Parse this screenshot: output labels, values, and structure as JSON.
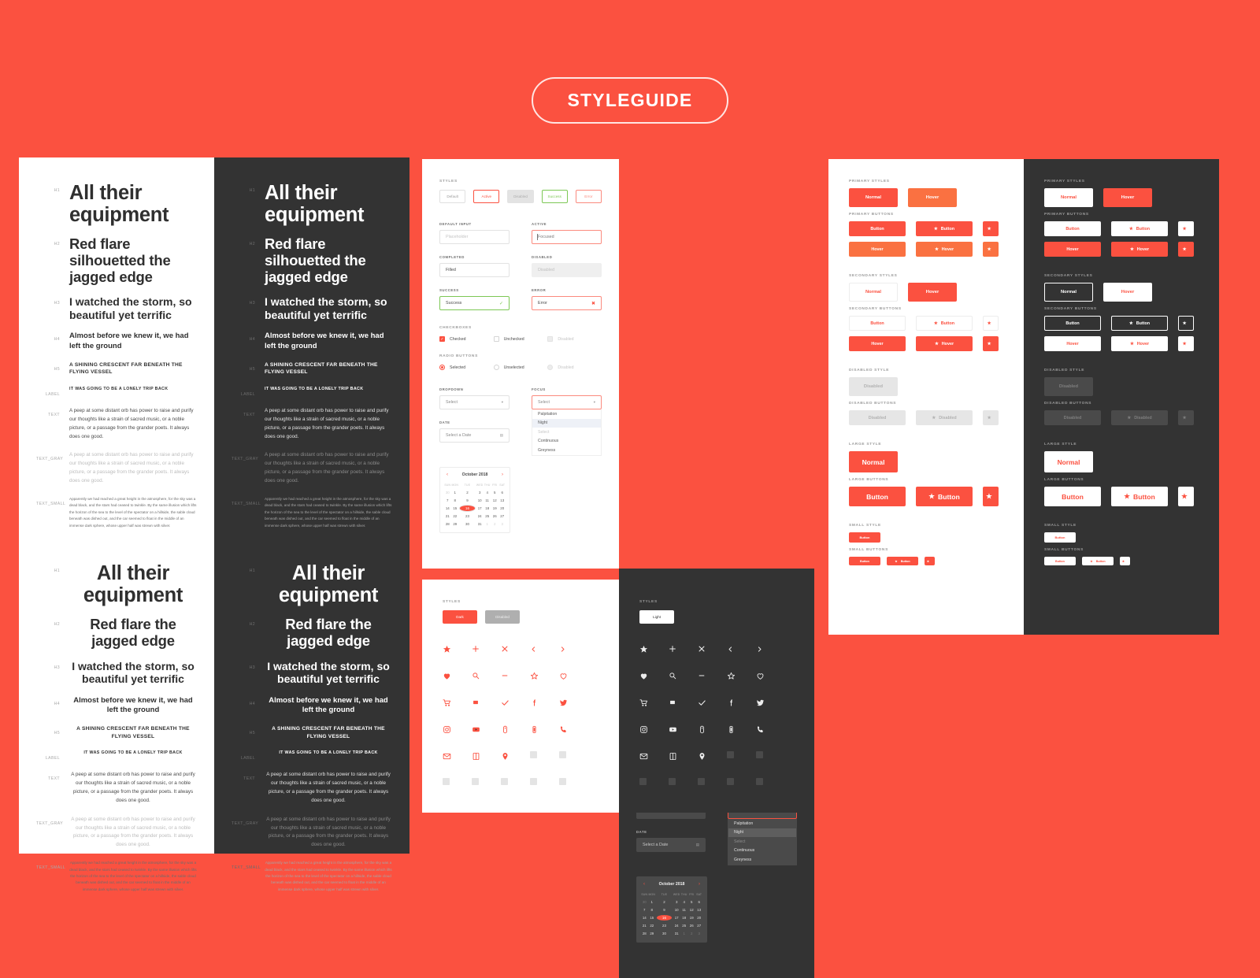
{
  "header": {
    "title": "STYLEGUIDE"
  },
  "colors": {
    "background": "#FB5140",
    "primary_red": "#FB5140",
    "hover_orange": "#FA7141",
    "dark_panel": "#333333",
    "success_green": "#7DC855",
    "error_pink": "#FB8A7E"
  },
  "typography": {
    "tags": {
      "h1": "H1",
      "h2": "H2",
      "h3": "H3",
      "h4": "H4",
      "h5": "H5",
      "label": "Label",
      "text": "Text",
      "text_gray": "Text_gray",
      "text_small": "Text_small"
    },
    "left": {
      "h1": "All their equipment",
      "h2": "Red flare silhouetted the jagged edge",
      "h3": "I watched the storm, so beautiful yet terrific",
      "h4": "Almost before we knew it, we had left the ground",
      "h5": "A SHINING CRESCENT FAR BENEATH THE FLYING VESSEL",
      "label": "IT WAS GOING TO BE A LONELY TRIP BACK",
      "text": "A peep at some distant orb has power to raise and purify our thoughts like a strain of sacred music, or a noble picture, or a passage from the grander poets. It always does one good.",
      "text_gray": "A peep at some distant orb has power to raise and purify our thoughts like a strain of sacred music, or a noble picture, or a passage from the grander poets. It always does one good.",
      "text_small": "Apparently we had reached a great height in the atmosphere, for the sky was a dead black, and the stars had ceased to twinkle. By the same illusion which lifts the horizon of the sea to the level of the spectator on a hillside, the sable cloud beneath was dished out, and the car seemed to float in the middle of an immense dark sphere, whose upper half was strewn with silver."
    },
    "center": {
      "h1": "All their equipment",
      "h2": "Red flare the jagged edge",
      "h3": "I watched the storm, so beautiful yet terrific",
      "h4": "Almost before we knew it, we had left the ground",
      "h5": "A SHINING CRESCENT FAR BENEATH THE FLYING VESSEL",
      "label": "IT WAS GOING TO BE A LONELY TRIP BACK",
      "text": "A peep at some distant orb has power to raise and purify our thoughts like a strain of sacred music, or a noble picture, or a passage from the grander poets. It always does one good.",
      "text_gray": "A peep at some distant orb has power to raise and purify our thoughts like a strain of sacred music, or a noble picture, or a passage from the grander poets. It always does one good.",
      "text_small": "Apparently we had reached a great height in the atmosphere, for the sky was a dead black, and the stars had ceased to twinkle. By the same illusion which lifts the horizon of the sea to the level of the spectator on a hillside, the sable cloud beneath was dished out, and the car seemed to float in the middle of an immense dark sphere, whose upper half was strewn with silver."
    }
  },
  "forms": {
    "styles_label": "STYLES",
    "chips": [
      {
        "label": "Default",
        "state": "default"
      },
      {
        "label": "Active",
        "state": "active"
      },
      {
        "label": "Disabled",
        "state": "disabled"
      },
      {
        "label": "Success",
        "state": "success"
      },
      {
        "label": "Error",
        "state": "error"
      }
    ],
    "fields": [
      {
        "label": "DEFAULT INPUT",
        "value": "Placeholder",
        "state": "placeholder"
      },
      {
        "label": "ACTIVE",
        "value": "Focused",
        "state": "focus"
      },
      {
        "label": "COMPLETED",
        "value": "Filled",
        "state": "filled"
      },
      {
        "label": "DISABLED",
        "value": "Disabled",
        "state": "disabled"
      },
      {
        "label": "SUCCESS",
        "value": "Success",
        "state": "success",
        "indicator": "✓"
      },
      {
        "label": "ERROR",
        "value": "Error",
        "state": "error",
        "indicator": "✖"
      }
    ],
    "checkboxes_label": "CHECKBOXES",
    "checkboxes": [
      {
        "label": "Checked",
        "state": "checked"
      },
      {
        "label": "Unchecked",
        "state": "unchecked"
      },
      {
        "label": "Disabled",
        "state": "disabled"
      }
    ],
    "radios_label": "RADIO BUTTONS",
    "radios": [
      {
        "label": "Selected",
        "state": "selected"
      },
      {
        "label": "Unselected",
        "state": "unselected"
      },
      {
        "label": "Disabled",
        "state": "disabled"
      }
    ],
    "dropdown_label": "DROPDOWN",
    "dropdown_value": "Select",
    "focus_label": "FOCUS",
    "focus_value": "Select",
    "dropdown_options": [
      {
        "label": "Palpitation",
        "state": "normal"
      },
      {
        "label": "Night",
        "state": "highlighted"
      },
      {
        "label": "Select",
        "state": "muted"
      },
      {
        "label": "Continuous",
        "state": "normal"
      },
      {
        "label": "Greyness",
        "state": "normal"
      }
    ],
    "date_label": "DATE",
    "date_value": "Select a Date",
    "calendar": {
      "title": "October 2018",
      "prev": "‹",
      "next": "›",
      "dow": [
        "SUN",
        "MON",
        "TUE",
        "WED",
        "THU",
        "FRI",
        "SAT"
      ],
      "weeks": [
        [
          {
            "d": "30",
            "m": true
          },
          {
            "d": "1"
          },
          {
            "d": "2"
          },
          {
            "d": "3"
          },
          {
            "d": "4"
          },
          {
            "d": "5"
          },
          {
            "d": "6"
          }
        ],
        [
          {
            "d": "7"
          },
          {
            "d": "8"
          },
          {
            "d": "9"
          },
          {
            "d": "10"
          },
          {
            "d": "11"
          },
          {
            "d": "12"
          },
          {
            "d": "13"
          }
        ],
        [
          {
            "d": "14"
          },
          {
            "d": "15"
          },
          {
            "d": "16",
            "sel": true
          },
          {
            "d": "17"
          },
          {
            "d": "18"
          },
          {
            "d": "19"
          },
          {
            "d": "20"
          }
        ],
        [
          {
            "d": "21"
          },
          {
            "d": "22"
          },
          {
            "d": "23"
          },
          {
            "d": "24"
          },
          {
            "d": "25"
          },
          {
            "d": "26"
          },
          {
            "d": "27"
          }
        ],
        [
          {
            "d": "28"
          },
          {
            "d": "29"
          },
          {
            "d": "30"
          },
          {
            "d": "31"
          },
          {
            "d": "1",
            "m": true
          },
          {
            "d": "2",
            "m": true
          },
          {
            "d": "3",
            "m": true
          }
        ]
      ]
    }
  },
  "buttons": {
    "sections": {
      "primary_styles": "PRIMARY STYLES",
      "primary_buttons": "PRIMARY BUTTONS",
      "secondary_styles": "SECONDARY STYLES",
      "secondary_buttons": "SECONDARY BUTTONS",
      "disabled_style": "DISABLED STYLE",
      "disabled_buttons": "DISABLED BUTTONS",
      "large_style": "LARGE STYLE",
      "large_buttons": "LARGE BUTTONS",
      "small_style": "SMALL STYLE",
      "small_buttons": "SMALL BUTTONS"
    },
    "labels": {
      "normal": "Normal",
      "hover": "Hover",
      "button": "Button",
      "disabled": "Disabled"
    },
    "star_icon": "★"
  },
  "icons": {
    "styles_label": "STYLES",
    "light_chips": [
      {
        "label": "Dark",
        "state": "active"
      },
      {
        "label": "Disabled",
        "state": "disabled"
      }
    ],
    "dark_chips": [
      {
        "label": "Light",
        "state": "active"
      }
    ],
    "grid": [
      "star-filled-icon",
      "plus-icon",
      "close-icon",
      "chevron-left-icon",
      "chevron-right-icon",
      "heart-filled-icon",
      "search-icon",
      "minus-icon",
      "star-outline-icon",
      "heart-outline-icon",
      "cart-icon",
      "stop-square-icon",
      "check-icon",
      "facebook-icon",
      "twitter-icon",
      "instagram-icon",
      "youtube-icon",
      "mouse-icon",
      "battery-icon",
      "phone-icon",
      "mail-icon",
      "dribbble-icon",
      "location-pin-icon",
      "placeholder-icon",
      "placeholder-icon",
      "placeholder-icon",
      "placeholder-icon",
      "placeholder-icon",
      "placeholder-icon",
      "placeholder-icon"
    ]
  }
}
